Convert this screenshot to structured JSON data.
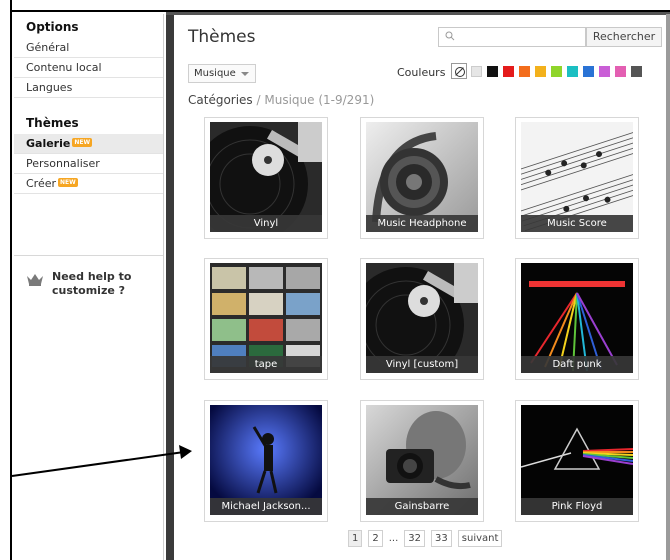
{
  "sidebar": {
    "options_title": "Options",
    "options_items": [
      {
        "label": "Général"
      },
      {
        "label": "Contenu local"
      },
      {
        "label": "Langues"
      }
    ],
    "themes_title": "Thèmes",
    "themes_items": [
      {
        "label": "Galerie",
        "badge": "NEW",
        "active": true
      },
      {
        "label": "Personnaliser"
      },
      {
        "label": "Créer",
        "badge": "NEW"
      }
    ],
    "help_text": "Need help to customize ?"
  },
  "main": {
    "title": "Thèmes",
    "search": {
      "placeholder": "",
      "button_label": "Rechercher"
    },
    "category_select": {
      "value": "Musique"
    },
    "colors_label": "Couleurs",
    "color_swatches": [
      "#e6e6e6",
      "#111111",
      "#e41b1b",
      "#f36d1c",
      "#f3b11c",
      "#8fd52a",
      "#1bbfc2",
      "#2a73d5",
      "#c95ed6",
      "#e35fb2",
      "#555555"
    ],
    "breadcrumb": {
      "root": "Catégories",
      "separator": "/",
      "current": "Musique (1-9/291)"
    },
    "themes": [
      {
        "label": "Vinyl",
        "icon": "vinyl-turntable-image"
      },
      {
        "label": "Music Headphone",
        "icon": "headphone-image"
      },
      {
        "label": "Music Score",
        "icon": "music-score-image"
      },
      {
        "label": "tape",
        "icon": "cassette-tapes-image"
      },
      {
        "label": "Vinyl [custom]",
        "icon": "vinyl-turntable-image"
      },
      {
        "label": "Daft punk",
        "icon": "daft-punk-image"
      },
      {
        "label": "Michael Jackson...",
        "icon": "michael-jackson-image"
      },
      {
        "label": "Gainsbarre",
        "icon": "gainsbarre-image"
      },
      {
        "label": "Pink Floyd",
        "icon": "pink-floyd-prism-image"
      }
    ],
    "pagination": {
      "pages": [
        "1",
        "2",
        "...",
        "32",
        "33"
      ],
      "next_label": "suivant",
      "current": "1"
    }
  }
}
